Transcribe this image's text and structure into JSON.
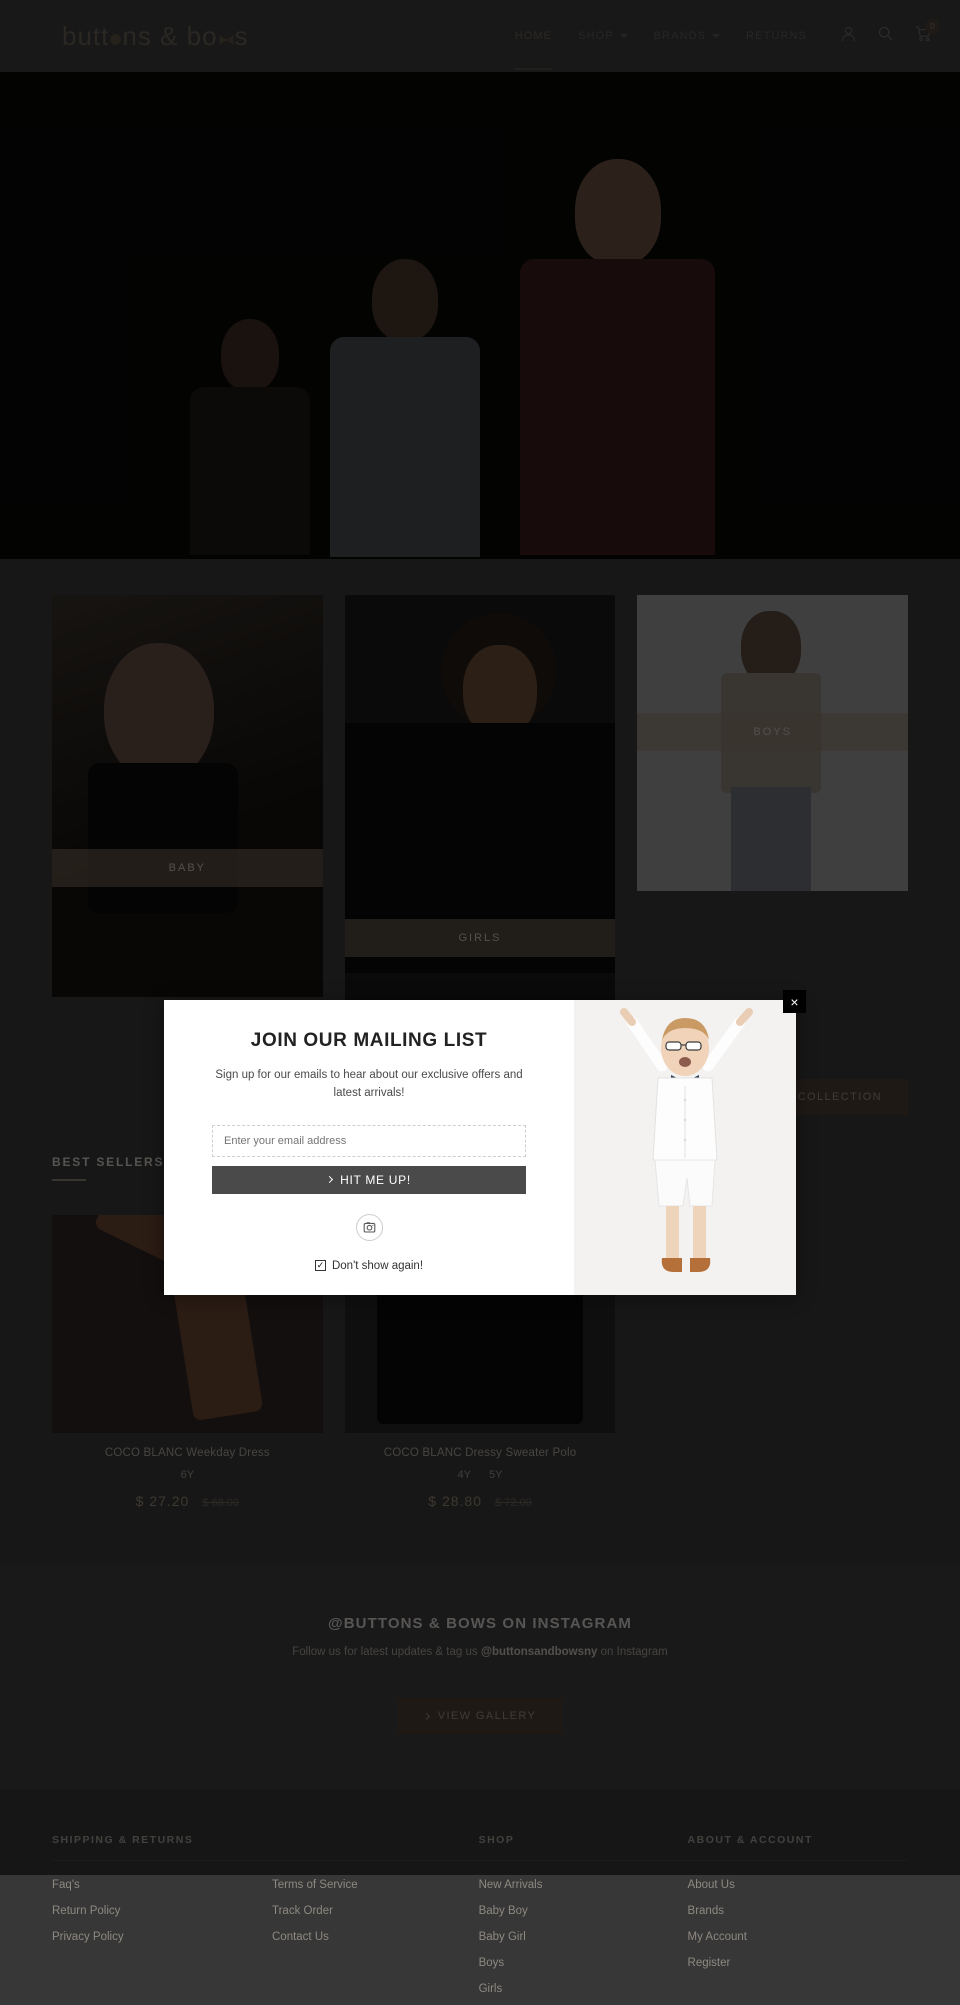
{
  "header": {
    "logo_text_parts": [
      "butt",
      "ns & bo",
      "s"
    ],
    "logo_alt": "buttons & bows",
    "nav": [
      {
        "label": "HOME",
        "has_caret": false,
        "active": true
      },
      {
        "label": "SHOP",
        "has_caret": true,
        "active": false
      },
      {
        "label": "BRANDS",
        "has_caret": true,
        "active": false
      },
      {
        "label": "RETURNS",
        "has_caret": false,
        "active": false
      }
    ],
    "icons": [
      {
        "name": "account-icon",
        "glyph": "account"
      },
      {
        "name": "search-icon",
        "glyph": "search"
      },
      {
        "name": "cart-icon",
        "glyph": "cart"
      }
    ],
    "cart_count": "0"
  },
  "categories": [
    {
      "label": "BABY"
    },
    {
      "label": "GIRLS"
    },
    {
      "label": "BOYS"
    }
  ],
  "shop_collection_button": "SHOP TO COLLECTION",
  "best_sellers": {
    "heading": "BEST SELLERS",
    "products": [
      {
        "title": "COCO BLANC Weekday Dress",
        "sizes": [
          "6Y"
        ],
        "price_sale": "$ 27.20",
        "price_was": "$ 68.00"
      },
      {
        "title": "COCO BLANC Dressy Sweater Polo",
        "sizes": [
          "4Y",
          "5Y"
        ],
        "price_sale": "$ 28.80",
        "price_was": "$ 72.00"
      }
    ]
  },
  "instagram": {
    "heading": "@BUTTONS & BOWS ON INSTAGRAM",
    "sub_prefix": "Follow us for latest updates & tag us ",
    "handle": "@buttonsandbowsny",
    "sub_suffix": " on Instagram",
    "button": "VIEW GALLERY"
  },
  "footer": {
    "shipping": {
      "heading": "SHIPPING & RETURNS",
      "col1": [
        "Faq's",
        "Return Policy",
        "Privacy Policy"
      ],
      "col2": [
        "Terms of Service",
        "Track Order",
        "Contact Us"
      ]
    },
    "shop": {
      "heading": "SHOP",
      "links": [
        "New Arrivals",
        "Baby Boy",
        "Baby Girl",
        "Boys",
        "Girls"
      ]
    },
    "about": {
      "heading": "ABOUT & ACCOUNT",
      "links": [
        "About Us",
        "Brands",
        "My Account",
        "Register"
      ]
    }
  },
  "modal": {
    "title": "JOIN OUR MAILING LIST",
    "subtitle": "Sign up for our emails to hear about our exclusive offers and latest arrivals!",
    "email_placeholder": "Enter your email address",
    "email_value": "",
    "submit_label": "HIT ME UP!",
    "social_icon": "instagram-icon",
    "dont_show_label": "Don't show again!",
    "dont_show_checked": true,
    "close_label": "×"
  },
  "colors": {
    "page_bg": "#3a3a3a",
    "header_bg": "#3c3c3c",
    "accent_tan": "#9a8d78",
    "button_dark": "#4e4038",
    "modal_bg": "#ffffff",
    "modal_button": "#4a4a4a"
  }
}
